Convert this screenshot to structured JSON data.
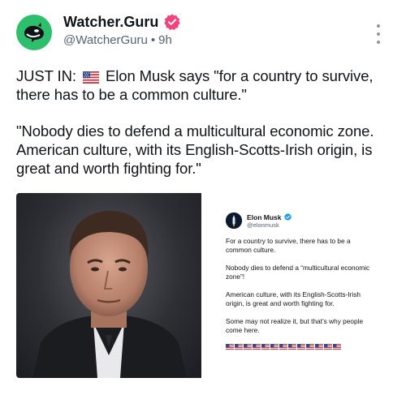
{
  "account": {
    "display_name": "Watcher.Guru",
    "handle": "@WatcherGuru",
    "separator": "•",
    "time_ago": "9h"
  },
  "post": {
    "line1_prefix": "JUST IN:",
    "line1_rest": "Elon Musk says \"for a country to survive, there has to be a common culture.\"",
    "paragraph2": "\"Nobody dies to defend a multicultural economic zone. American culture, with its English-Scotts-Irish origin, is great and worth fighting for.\""
  },
  "embedded_post": {
    "name": "Elon Musk",
    "handle": "@elonmusk",
    "p1": "For a country to survive, there has to be a common culture.",
    "p2": "Nobody dies to defend a “multicultural economic zone”!",
    "p3": "American culture, with its English-Scotts-Irish origin, is great and worth fighting for.",
    "p4": "Some may not realize it, but that’s why people come here.",
    "flag_count": 13
  },
  "icons": {
    "avatar": "orca-logo-icon",
    "verified": "verified-badge-icon",
    "more": "more-options-icon",
    "flag": "us-flag-icon"
  },
  "colors": {
    "avatar_bg": "#2dbf6b",
    "verified_badge": "#f4427d",
    "muted_text": "#536471",
    "embed_verified": "#1d9bf0"
  }
}
